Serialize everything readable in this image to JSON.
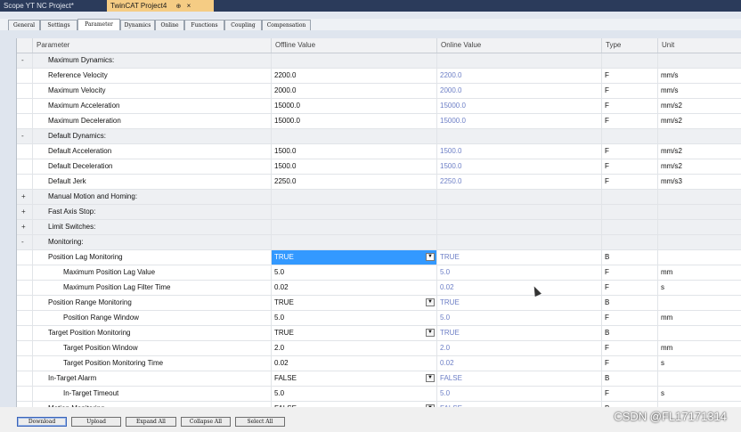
{
  "doc_tabs": [
    {
      "label": "Scope YT NC Project*"
    },
    {
      "label": "TwinCAT Project4",
      "pin": "⊕",
      "close": "×"
    }
  ],
  "panel_tabs": [
    "General",
    "Settings",
    "Parameter",
    "Dynamics",
    "Online",
    "Functions",
    "Coupling",
    "Compensation"
  ],
  "grid": {
    "columns": {
      "param": "Parameter",
      "offline": "Offline Value",
      "online": "Online Value",
      "type": "Type",
      "unit": "Unit"
    },
    "rows": [
      {
        "exp": "-",
        "param": "Maximum Dynamics:",
        "offline": "",
        "online": "",
        "type": "",
        "unit": "",
        "group": true
      },
      {
        "exp": "",
        "param": "Reference Velocity",
        "offline": "2200.0",
        "online": "2200.0",
        "type": "F",
        "unit": "mm/s"
      },
      {
        "exp": "",
        "param": "Maximum Velocity",
        "offline": "2000.0",
        "online": "2000.0",
        "type": "F",
        "unit": "mm/s"
      },
      {
        "exp": "",
        "param": "Maximum Acceleration",
        "offline": "15000.0",
        "online": "15000.0",
        "type": "F",
        "unit": "mm/s2"
      },
      {
        "exp": "",
        "param": "Maximum Deceleration",
        "offline": "15000.0",
        "online": "15000.0",
        "type": "F",
        "unit": "mm/s2"
      },
      {
        "exp": "-",
        "param": "Default Dynamics:",
        "offline": "",
        "online": "",
        "type": "",
        "unit": "",
        "group": true
      },
      {
        "exp": "",
        "param": "Default Acceleration",
        "offline": "1500.0",
        "online": "1500.0",
        "type": "F",
        "unit": "mm/s2"
      },
      {
        "exp": "",
        "param": "Default Deceleration",
        "offline": "1500.0",
        "online": "1500.0",
        "type": "F",
        "unit": "mm/s2"
      },
      {
        "exp": "",
        "param": "Default Jerk",
        "offline": "2250.0",
        "online": "2250.0",
        "type": "F",
        "unit": "mm/s3"
      },
      {
        "exp": "+",
        "param": "Manual Motion and Homing:",
        "offline": "",
        "online": "",
        "type": "",
        "unit": "",
        "group": true
      },
      {
        "exp": "+",
        "param": "Fast Axis Stop:",
        "offline": "",
        "online": "",
        "type": "",
        "unit": "",
        "group": true
      },
      {
        "exp": "+",
        "param": "Limit Switches:",
        "offline": "",
        "online": "",
        "type": "",
        "unit": "",
        "group": true
      },
      {
        "exp": "-",
        "param": "Monitoring:",
        "offline": "",
        "online": "",
        "type": "",
        "unit": "",
        "group": true
      },
      {
        "exp": "",
        "param": "Position Lag Monitoring",
        "offline": "TRUE",
        "online": "TRUE",
        "type": "B",
        "unit": "",
        "dropdown": true,
        "selected": true
      },
      {
        "exp": "",
        "param": "Maximum Position Lag Value",
        "offline": "5.0",
        "online": "5.0",
        "type": "F",
        "unit": "mm",
        "indent": true
      },
      {
        "exp": "",
        "param": "Maximum Position Lag Filter Time",
        "offline": "0.02",
        "online": "0.02",
        "type": "F",
        "unit": "s",
        "indent": true
      },
      {
        "exp": "",
        "param": "Position Range Monitoring",
        "offline": "TRUE",
        "online": "TRUE",
        "type": "B",
        "unit": "",
        "dropdown": true
      },
      {
        "exp": "",
        "param": "Position Range Window",
        "offline": "5.0",
        "online": "5.0",
        "type": "F",
        "unit": "mm",
        "indent": true
      },
      {
        "exp": "",
        "param": "Target Position Monitoring",
        "offline": "TRUE",
        "online": "TRUE",
        "type": "B",
        "unit": "",
        "dropdown": true
      },
      {
        "exp": "",
        "param": "Target Position Window",
        "offline": "2.0",
        "online": "2.0",
        "type": "F",
        "unit": "mm",
        "indent": true
      },
      {
        "exp": "",
        "param": "Target Position Monitoring Time",
        "offline": "0.02",
        "online": "0.02",
        "type": "F",
        "unit": "s",
        "indent": true
      },
      {
        "exp": "",
        "param": "In-Target Alarm",
        "offline": "FALSE",
        "online": "FALSE",
        "type": "B",
        "unit": "",
        "dropdown": true
      },
      {
        "exp": "",
        "param": "In-Target Timeout",
        "offline": "5.0",
        "online": "5.0",
        "type": "F",
        "unit": "s",
        "indent": true
      },
      {
        "exp": "",
        "param": "Motion Monitoring",
        "offline": "FALSE",
        "online": "FALSE",
        "type": "B",
        "unit": "",
        "dropdown": true
      }
    ]
  },
  "buttons": {
    "download": "Download",
    "upload": "Upload",
    "expand": "Expand All",
    "collapse": "Collapse All",
    "select": "Select All"
  },
  "watermark": "CSDN @FL17171314",
  "colors": {
    "accent_tab": "#f5cc84",
    "selection": "#3399ff",
    "online_value": "#6d7fc6"
  }
}
